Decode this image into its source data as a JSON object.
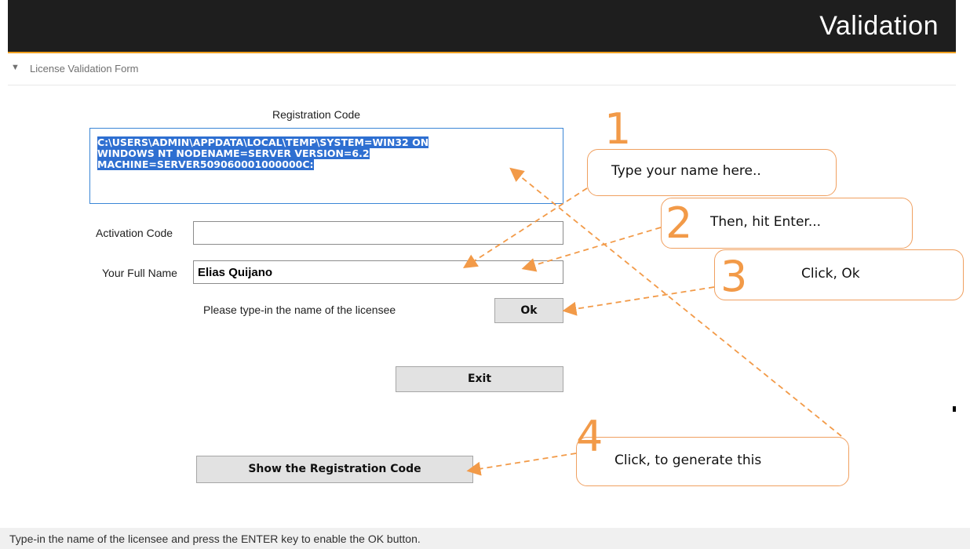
{
  "window": {
    "title": "Validation"
  },
  "section": {
    "label": "License Validation Form"
  },
  "form": {
    "registration_code_label": "Registration Code",
    "registration_code_lines": [
      "C:\\USERS\\ADMIN\\APPDATA\\LOCAL\\TEMP\\SYSTEM=WIN32 ON",
      "WINDOWS NT NODENAME=SERVER VERSION=6.2",
      "MACHINE=SERVER509060001000000C:"
    ],
    "activation_code_label": "Activation Code",
    "activation_code_value": "",
    "full_name_label": "Your Full Name",
    "full_name_value": "Elias Quijano",
    "hint": "Please type-in the name of the licensee",
    "ok_label": "Ok",
    "exit_label": "Exit",
    "show_reg_code_label": "Show the Registration Code"
  },
  "status": {
    "text": "Type-in the name of the licensee and  press the ENTER key to enable the OK button."
  },
  "annotations": {
    "step1": {
      "number": "1",
      "text": "Type your name here.."
    },
    "step2": {
      "number": "2",
      "text": "Then, hit Enter..."
    },
    "step3": {
      "number": "3",
      "text": "Click, Ok"
    },
    "step4": {
      "number": "4",
      "text": "Click, to generate this"
    },
    "color": "#f29a48"
  }
}
